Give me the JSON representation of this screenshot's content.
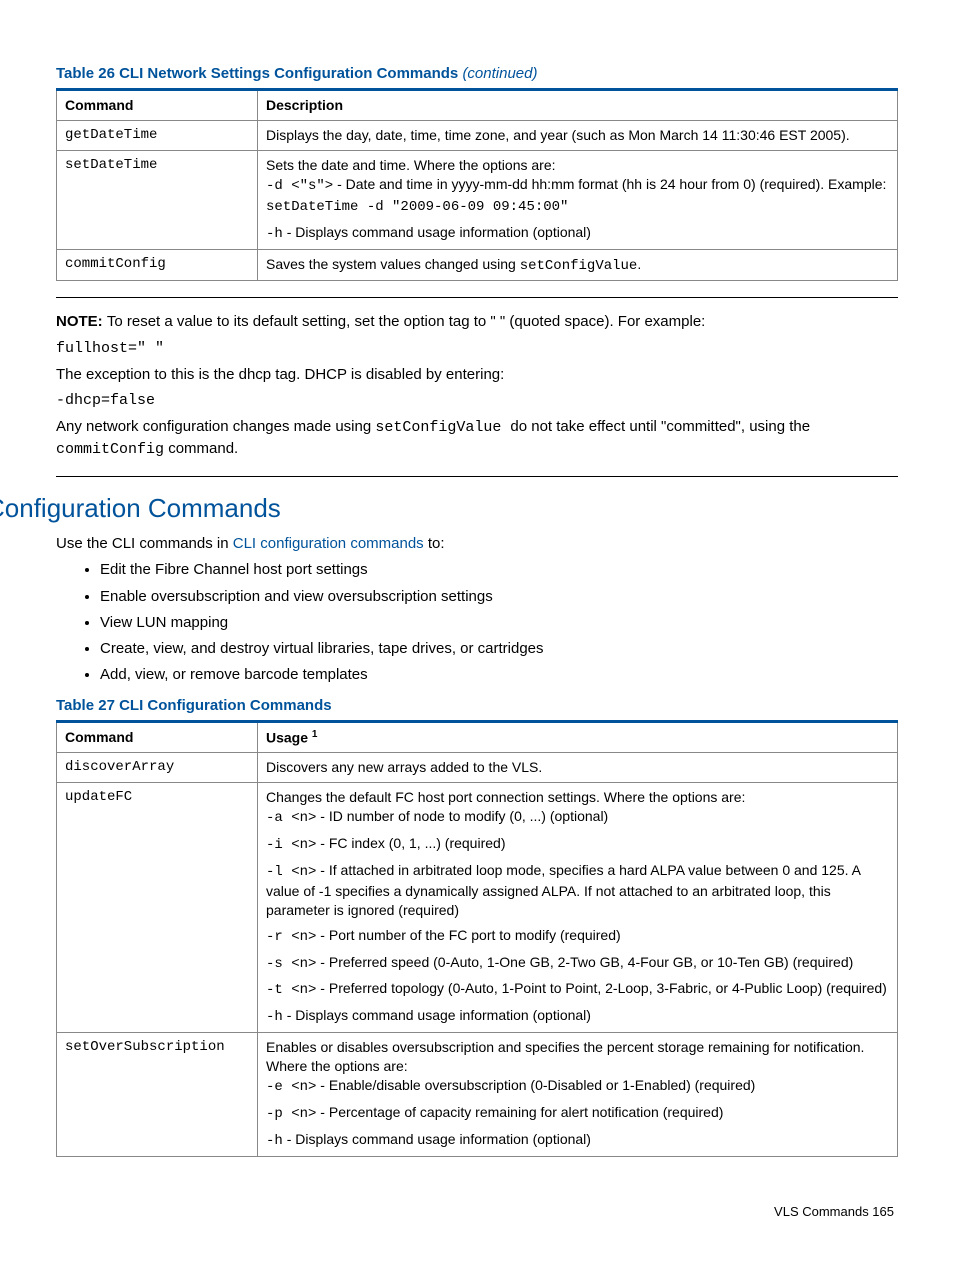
{
  "table26": {
    "caption_main": "Table 26 CLI Network Settings Configuration Commands ",
    "caption_cont": "(continued)",
    "head_cmd": "Command",
    "head_desc": "Description",
    "r1_cmd": "getDateTime",
    "r1_desc": "Displays the day, date, time, time zone, and year (such as Mon March 14 11:30:46 EST 2005).",
    "r2_cmd": "setDateTime",
    "r2_desc_intro": "Sets the date and time. Where the options are:",
    "r2_opt1_flag": "-d <\"s\">",
    "r2_opt1_rest": " - Date and time in yyyy-mm-dd hh:mm format (hh is 24 hour from 0) (required). Example: ",
    "r2_opt1_example": "setDateTime -d \"2009-06-09 09:45:00\"",
    "r2_opt2_flag": "-h",
    "r2_opt2_rest": " - Displays command usage information (optional)",
    "r3_cmd": "commitConfig",
    "r3_desc_pre": "Saves the system values changed using ",
    "r3_desc_mono": "setConfigValue",
    "r3_desc_post": "."
  },
  "note": {
    "label": "NOTE:   ",
    "line1": "To reset a value to its default setting, set the option tag to \" \" (quoted space). For example:",
    "mono1": "fullhost=\" \"",
    "line2": "The exception to this is the dhcp tag. DHCP is disabled by entering:",
    "mono2": "-dhcp=false",
    "line3_pre": "Any network configuration changes made using ",
    "line3_mono1": "setConfigValue ",
    "line3_mid": " do not take effect until \"committed\", using the ",
    "line3_mono2": "commitConfig",
    "line3_post": " command."
  },
  "section_title": "Configuration Commands",
  "intro_pre": "Use the CLI commands in ",
  "intro_link": "CLI configuration commands",
  "intro_post": " to:",
  "bullets": {
    "b1": "Edit the Fibre Channel host port settings",
    "b2": "Enable oversubscription and view oversubscription settings",
    "b3": "View LUN mapping",
    "b4": "Create, view, and destroy virtual libraries, tape drives, or cartridges",
    "b5": "Add, view, or remove barcode templates"
  },
  "table27": {
    "caption": "Table 27 CLI Configuration Commands",
    "head_cmd": "Command",
    "head_usage": "Usage ",
    "r1_cmd": "discoverArray",
    "r1_desc": "Discovers any new arrays added to the VLS.",
    "r2_cmd": "updateFC",
    "r2_intro": "Changes the default FC host port connection settings. Where the options are:",
    "r2_a_flag": "-a  <n>",
    "r2_a_rest": " - ID number of node to modify (0, ...) (optional)",
    "r2_i_flag": "-i  <n>",
    "r2_i_rest": " - FC index (0, 1, ...) (required)",
    "r2_l_flag": "-l  <n>",
    "r2_l_rest": " - If attached in arbitrated loop mode, specifies a hard ALPA value between 0 and 125. A value of -1 specifies a dynamically assigned ALPA. If not attached to an arbitrated loop, this parameter is ignored (required)",
    "r2_r_flag": "-r  <n>",
    "r2_r_rest": " - Port number of the FC port to modify (required)",
    "r2_s_flag": "-s  <n>",
    "r2_s_rest": " - Preferred speed (0-Auto, 1-One GB, 2-Two GB, 4-Four GB, or 10-Ten GB) (required)",
    "r2_t_flag": "-t  <n>",
    "r2_t_rest": " - Preferred topology (0-Auto, 1-Point to Point, 2-Loop, 3-Fabric, or 4-Public Loop) (required)",
    "r2_h_flag": "-h",
    "r2_h_rest": " - Displays command usage information (optional)",
    "r3_cmd": "setOverSubscription",
    "r3_intro": "Enables or disables oversubscription and specifies the percent storage remaining for notification. Where the options are:",
    "r3_e_flag": "-e  <n>",
    "r3_e_rest": " - Enable/disable oversubscription (0-Disabled or 1-Enabled) (required)",
    "r3_p_flag": "-p  <n>",
    "r3_p_rest": " - Percentage of capacity remaining for alert notification (required)",
    "r3_h_flag": "-h",
    "r3_h_rest": " - Displays command usage information (optional)"
  },
  "footer": "VLS Commands   165"
}
